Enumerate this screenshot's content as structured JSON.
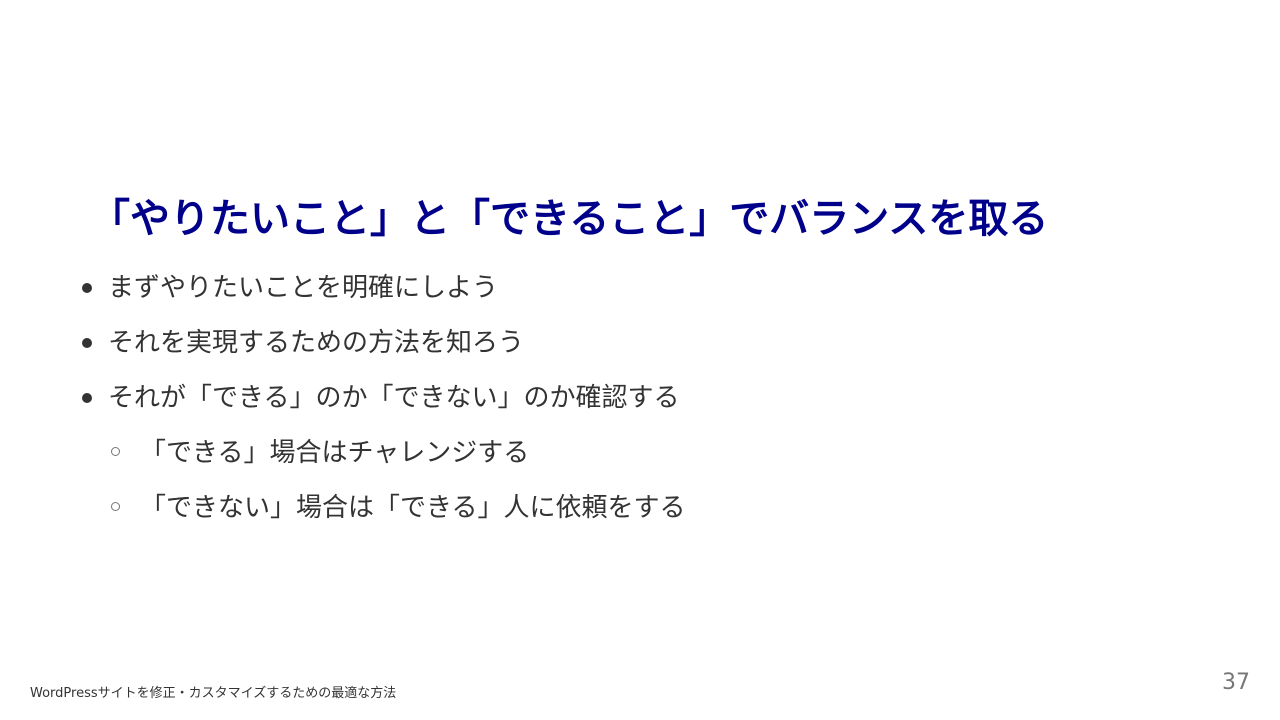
{
  "slide": {
    "title": "「やりたいこと」と「できること」でバランスを取る",
    "bullets": [
      {
        "level": 1,
        "text": "まずやりたいことを明確にしよう"
      },
      {
        "level": 1,
        "text": "それを実現するための方法を知ろう"
      },
      {
        "level": 1,
        "text": "それが「できる」のか「できない」のか確認する"
      },
      {
        "level": 2,
        "text": "「できる」場合はチャレンジする"
      },
      {
        "level": 2,
        "text": "「できない」場合は「できる」人に依頼をする"
      }
    ],
    "footer": "WordPressサイトを修正・カスタマイズするための最適な方法",
    "page_number": "37"
  },
  "colors": {
    "title": "#00008b",
    "text": "#333333",
    "page_number": "#777777"
  }
}
